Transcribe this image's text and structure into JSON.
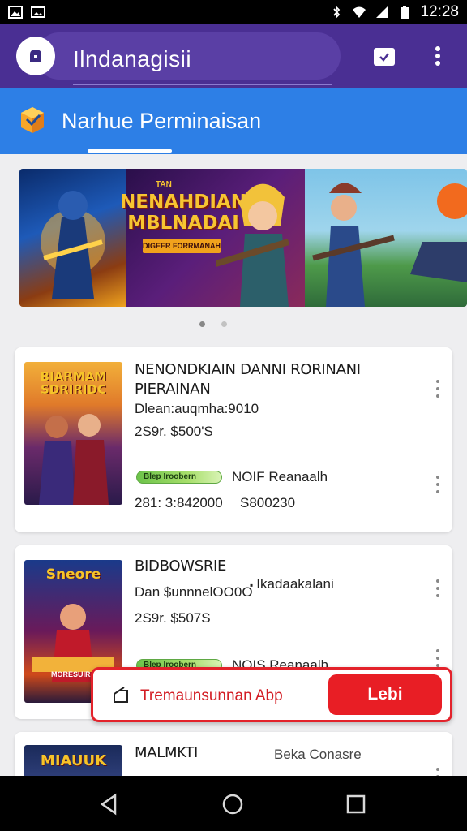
{
  "status_bar": {
    "time": "12:28",
    "left_icons": [
      "image-icon",
      "photo-icon"
    ],
    "right_icons": [
      "bluetooth-icon",
      "wifi-icon",
      "signal-icon",
      "battery-icon"
    ]
  },
  "app_bar": {
    "title": "Ilndanagisii",
    "logo_icon": "app-logo-icon",
    "actions": [
      "calendar-check-icon",
      "more-vert-icon"
    ]
  },
  "section": {
    "title": "Narhue Perminaisan",
    "icon": "cube-icon"
  },
  "banner": {
    "title_line1": "NENAHDIAN",
    "title_line2": "MBLNADAI",
    "title_small": "TAN",
    "button": "DIGEER FORRMANAH",
    "dots": 2,
    "active_dot": 0
  },
  "cards": [
    {
      "thumb_title": "BIARMAM\nSDRIRIDC",
      "title": "NENONDKIAIN DANNI RORINANI PIERAINAN",
      "meta1": "Dlean:auqmha:9010",
      "meta2": "2S9r. $500'S",
      "pill": "Blep Iroobern",
      "label": "NOIF Reanaalh",
      "stat1": "281: 3:842000",
      "stat2": "S800230"
    },
    {
      "thumb_title": "Sneore",
      "thumb_sub": "MORESUIRA",
      "title": "BIDBOWSRIE",
      "meta1": "Dan $unnnelOO0O",
      "meta2": "2S9r. $507S",
      "side_text": "Ikadaakalani",
      "pill": "Blep Iroobern",
      "label": "NOIS Reanaalh"
    },
    {
      "thumb_title": "MIAUUK",
      "title": "MALMKTI",
      "side_text": "Beka Conasre"
    }
  ],
  "toast": {
    "text": "Tremaunsunnan Abp",
    "button": "Lebi",
    "icon": "share-icon"
  },
  "nav_bar": {
    "buttons": [
      "back-icon",
      "home-icon",
      "recents-icon"
    ]
  },
  "colors": {
    "app_bar": "#4a2f93",
    "section": "#2d7fe6",
    "accent_red": "#e81e25",
    "background": "#eeeef0"
  }
}
